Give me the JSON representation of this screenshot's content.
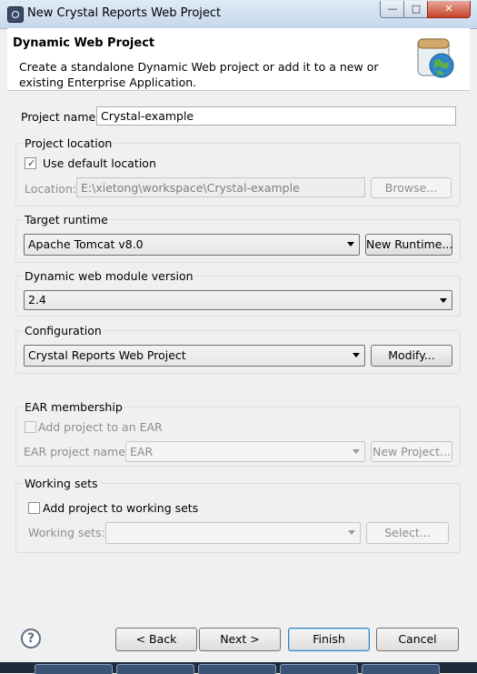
{
  "window": {
    "title": "New Crystal Reports Web Project"
  },
  "header": {
    "title": "Dynamic Web Project",
    "description": "Create a standalone Dynamic Web project or add it to a new or existing Enterprise Application."
  },
  "project_name": {
    "label": "Project name:",
    "value": "Crystal-example"
  },
  "project_location": {
    "group_title": "Project location",
    "use_default_label": "Use default location",
    "use_default_checked": true,
    "location_label": "Location:",
    "location_value": "E:\\xietong\\workspace\\Crystal-example",
    "browse_label": "Browse..."
  },
  "target_runtime": {
    "group_title": "Target runtime",
    "selected": "Apache Tomcat v8.0",
    "new_runtime_label": "New Runtime..."
  },
  "module_version": {
    "group_title": "Dynamic web module version",
    "selected": "2.4"
  },
  "configuration": {
    "group_title": "Configuration",
    "selected": "Crystal Reports Web Project",
    "modify_label": "Modify..."
  },
  "ear": {
    "group_title": "EAR membership",
    "add_label": "Add project to an EAR",
    "checked": false,
    "project_name_label": "EAR project name:",
    "project_name_value": "EAR",
    "new_project_label": "New Project..."
  },
  "working_sets": {
    "group_title": "Working sets",
    "add_label": "Add project to working sets",
    "checked": false,
    "sets_label": "Working sets:",
    "sets_value": "",
    "select_label": "Select..."
  },
  "footer": {
    "help_icon": "question-mark-icon",
    "back_label": "< Back",
    "next_label": "Next >",
    "finish_label": "Finish",
    "cancel_label": "Cancel"
  }
}
